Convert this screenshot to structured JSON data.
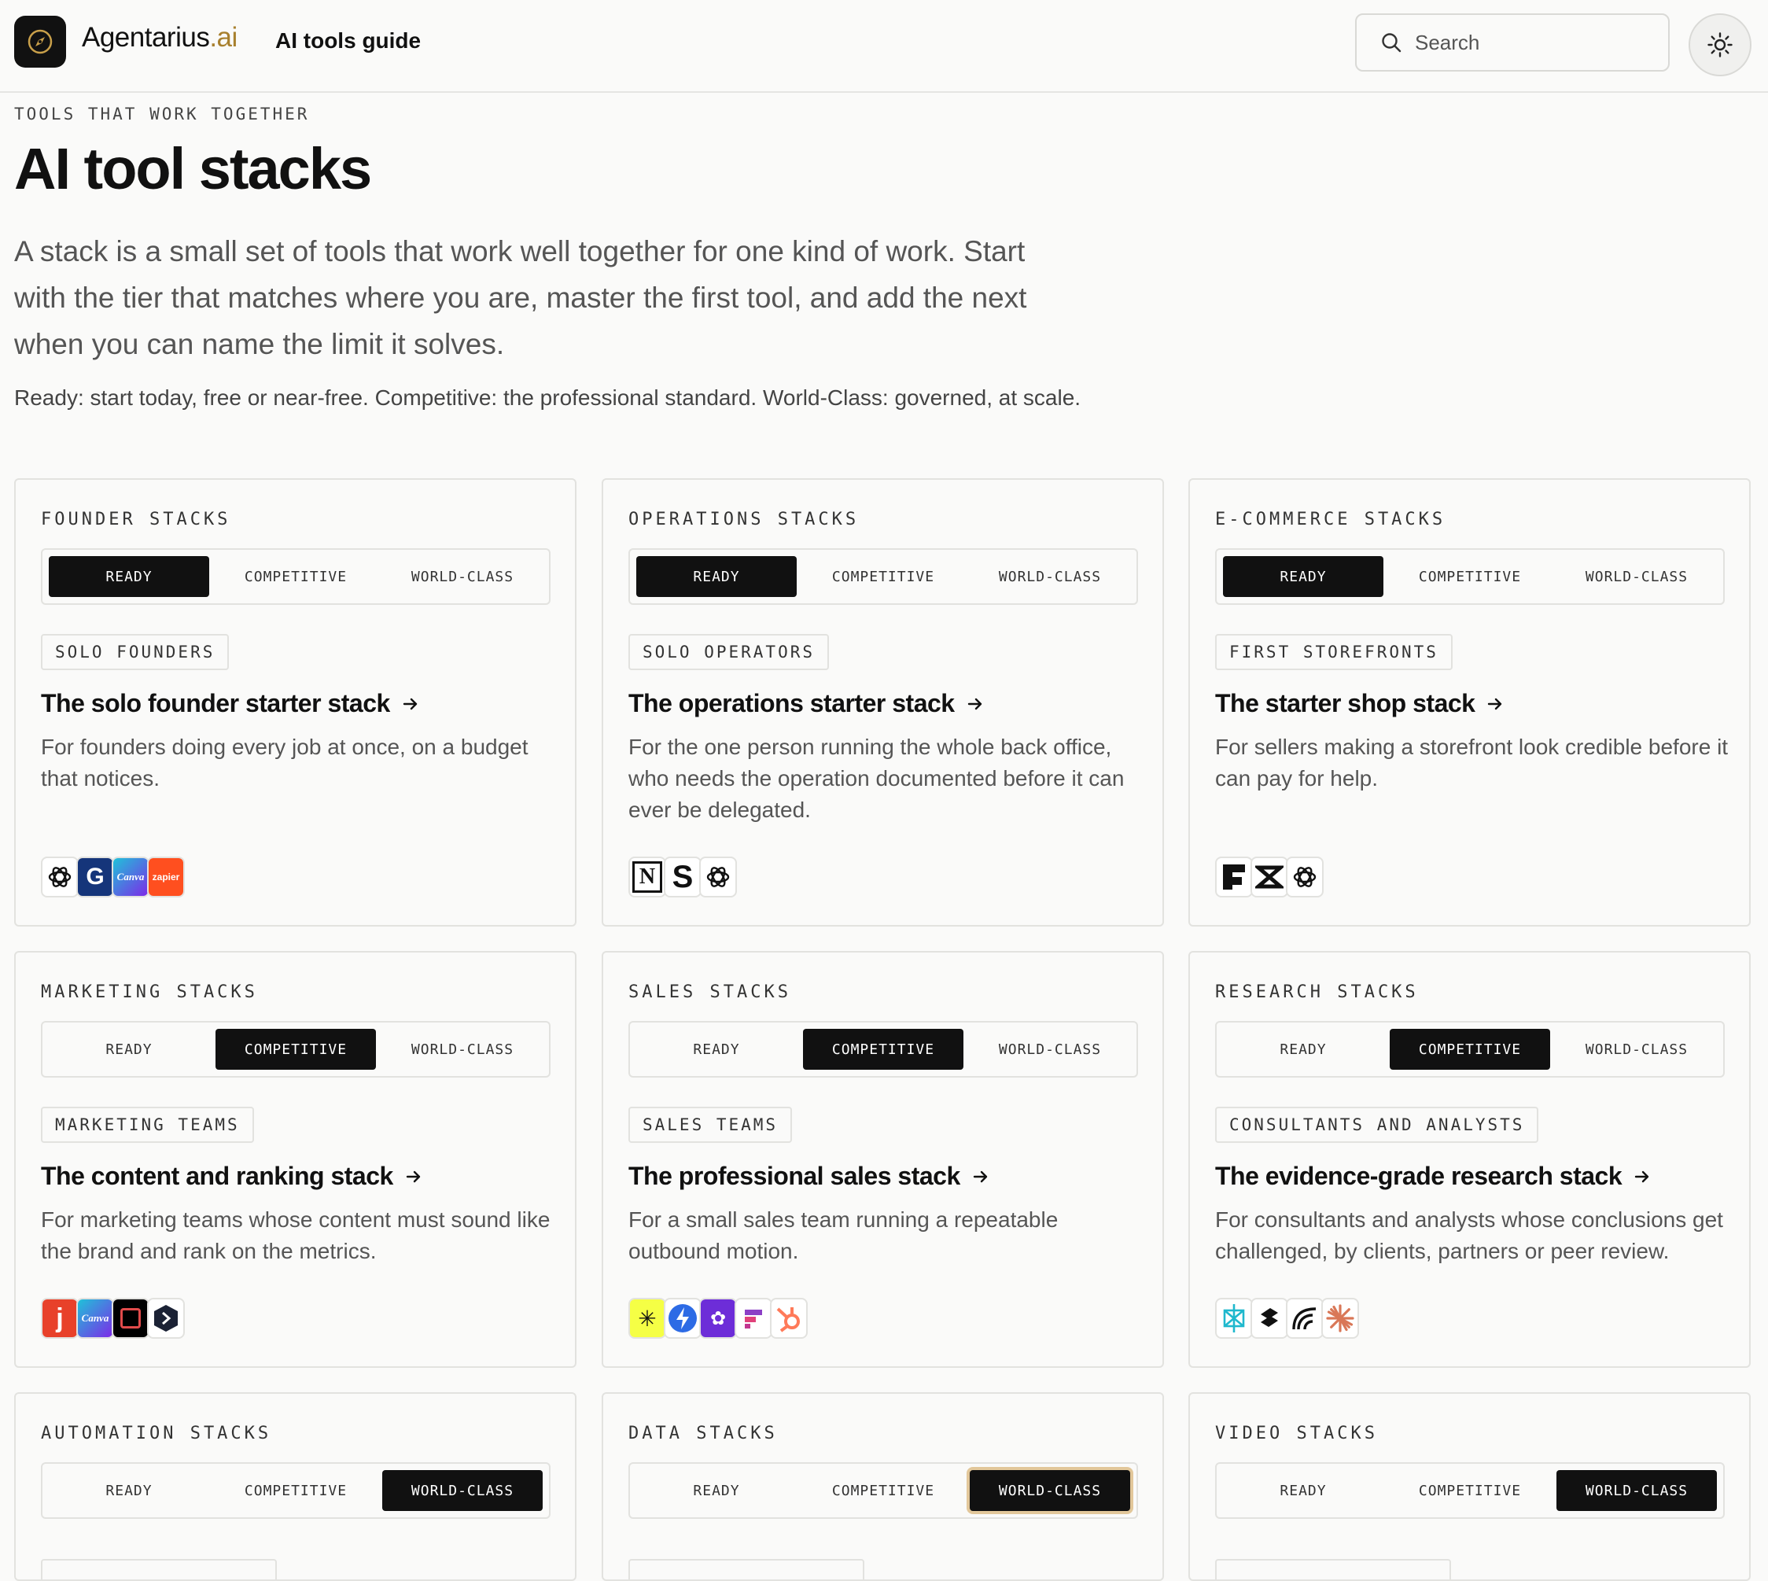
{
  "header": {
    "brand_name": "Agentarius",
    "brand_tld": ".ai",
    "nav_link": "AI tools guide",
    "search_placeholder": "Search"
  },
  "hero": {
    "eyebrow": "TOOLS THAT WORK TOGETHER",
    "title": "AI tool stacks",
    "lede": "A stack is a small set of tools that work well together for one kind of work. Start with the tier that matches where you are, master the first tool, and add the next when you can name the limit it solves.",
    "tiers_note": "Ready: start today, free or near-free. Competitive: the professional standard. World-Class: governed, at scale."
  },
  "tiers": [
    "READY",
    "COMPETITIVE",
    "WORLD-CLASS"
  ],
  "cards": [
    {
      "label": "FOUNDER STACKS",
      "active_tier": 0,
      "tag": "SOLO FOUNDERS",
      "title": "The solo founder starter stack",
      "desc": "For founders doing every job at once, on a budget that notices.",
      "icons": [
        "openai-icon",
        "grammarly-icon",
        "canva-icon",
        "zapier-icon"
      ]
    },
    {
      "label": "OPERATIONS STACKS",
      "active_tier": 0,
      "tag": "SOLO OPERATORS",
      "title": "The operations starter stack",
      "desc": "For the one person running the whole back office, who needs the operation documented before it can ever be delegated.",
      "icons": [
        "notion-icon",
        "scribe-icon",
        "openai-icon"
      ]
    },
    {
      "label": "E-COMMERCE STACKS",
      "active_tier": 0,
      "tag": "FIRST STOREFRONTS",
      "title": "The starter shop stack",
      "desc": "For sellers making a storefront look credible before it can pay for help.",
      "icons": [
        "framer-icon",
        "klaviyo-icon",
        "openai-icon"
      ]
    },
    {
      "label": "MARKETING STACKS",
      "active_tier": 1,
      "tag": "MARKETING TEAMS",
      "title": "The content and ranking stack",
      "desc": "For marketing teams whose content must sound like the brand and rank on the metrics.",
      "icons": [
        "jasper-icon",
        "canva-icon",
        "descript-icon",
        "surfer-icon"
      ]
    },
    {
      "label": "SALES STACKS",
      "active_tier": 1,
      "tag": "SALES TEAMS",
      "title": "The professional sales stack",
      "desc": "For a small sales team running a repeatable outbound motion.",
      "icons": [
        "apollo-icon",
        "lightning-icon",
        "lavender-icon",
        "gong-icon",
        "hubspot-icon"
      ]
    },
    {
      "label": "RESEARCH STACKS",
      "active_tier": 1,
      "tag": "CONSULTANTS AND ANALYSTS",
      "title": "The evidence-grade research stack",
      "desc": "For consultants and analysts whose conclusions get challenged, by clients, partners or peer review.",
      "icons": [
        "perplexity-icon",
        "elicit-icon",
        "consensus-icon",
        "claude-icon"
      ]
    },
    {
      "label": "AUTOMATION STACKS",
      "active_tier": 2,
      "tag": "",
      "title": "",
      "desc": "",
      "icons": []
    },
    {
      "label": "DATA STACKS",
      "active_tier": 2,
      "focused_tier": 2,
      "tag": "",
      "title": "",
      "desc": "",
      "icons": []
    },
    {
      "label": "VIDEO STACKS",
      "active_tier": 2,
      "tag": "",
      "title": "",
      "desc": "",
      "icons": []
    }
  ],
  "colors": {
    "background": "#fafaf9",
    "ink": "#111111",
    "muted": "#555555",
    "border": "#e2e2df",
    "brand_accent": "#a8802e",
    "focus_ring": "#e2c79a"
  }
}
